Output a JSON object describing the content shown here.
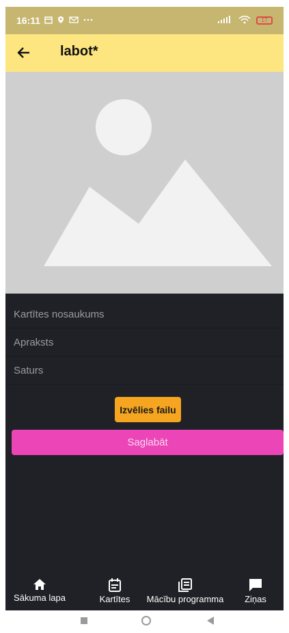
{
  "status_bar": {
    "time": "16:11",
    "icons": [
      "calendar-icon",
      "location-icon",
      "mail-icon",
      "more-icon"
    ],
    "right_icons": [
      "signal-icon",
      "wifi-icon",
      "battery-icon"
    ],
    "battery_level": "17"
  },
  "app_bar": {
    "back_icon": "arrow-left-icon",
    "title": "labot*"
  },
  "image_placeholder": {
    "icon": "image-placeholder-icon"
  },
  "form": {
    "title_placeholder": "Kartītes nosaukums",
    "description_placeholder": "Apraksts",
    "content_placeholder": "Saturs",
    "choose_file_label": "Izvēlies failu",
    "save_label": "Saglabāt"
  },
  "bottom_nav": {
    "items": [
      {
        "label": "Sākuma lapa",
        "icon": "home-icon"
      },
      {
        "label": "Kartītes",
        "icon": "calendar-icon"
      },
      {
        "label": "Mācību programma",
        "icon": "library-icon"
      },
      {
        "label": "Ziņas",
        "icon": "chat-icon"
      }
    ]
  },
  "system_nav": [
    "recents-icon",
    "home-circle-icon",
    "back-triangle-icon"
  ],
  "colors": {
    "status_bar": "#c6b670",
    "app_bar": "#fde57f",
    "form_bg": "#202126",
    "choose_button": "#f5a51f",
    "save_button": "#ec45b8"
  }
}
